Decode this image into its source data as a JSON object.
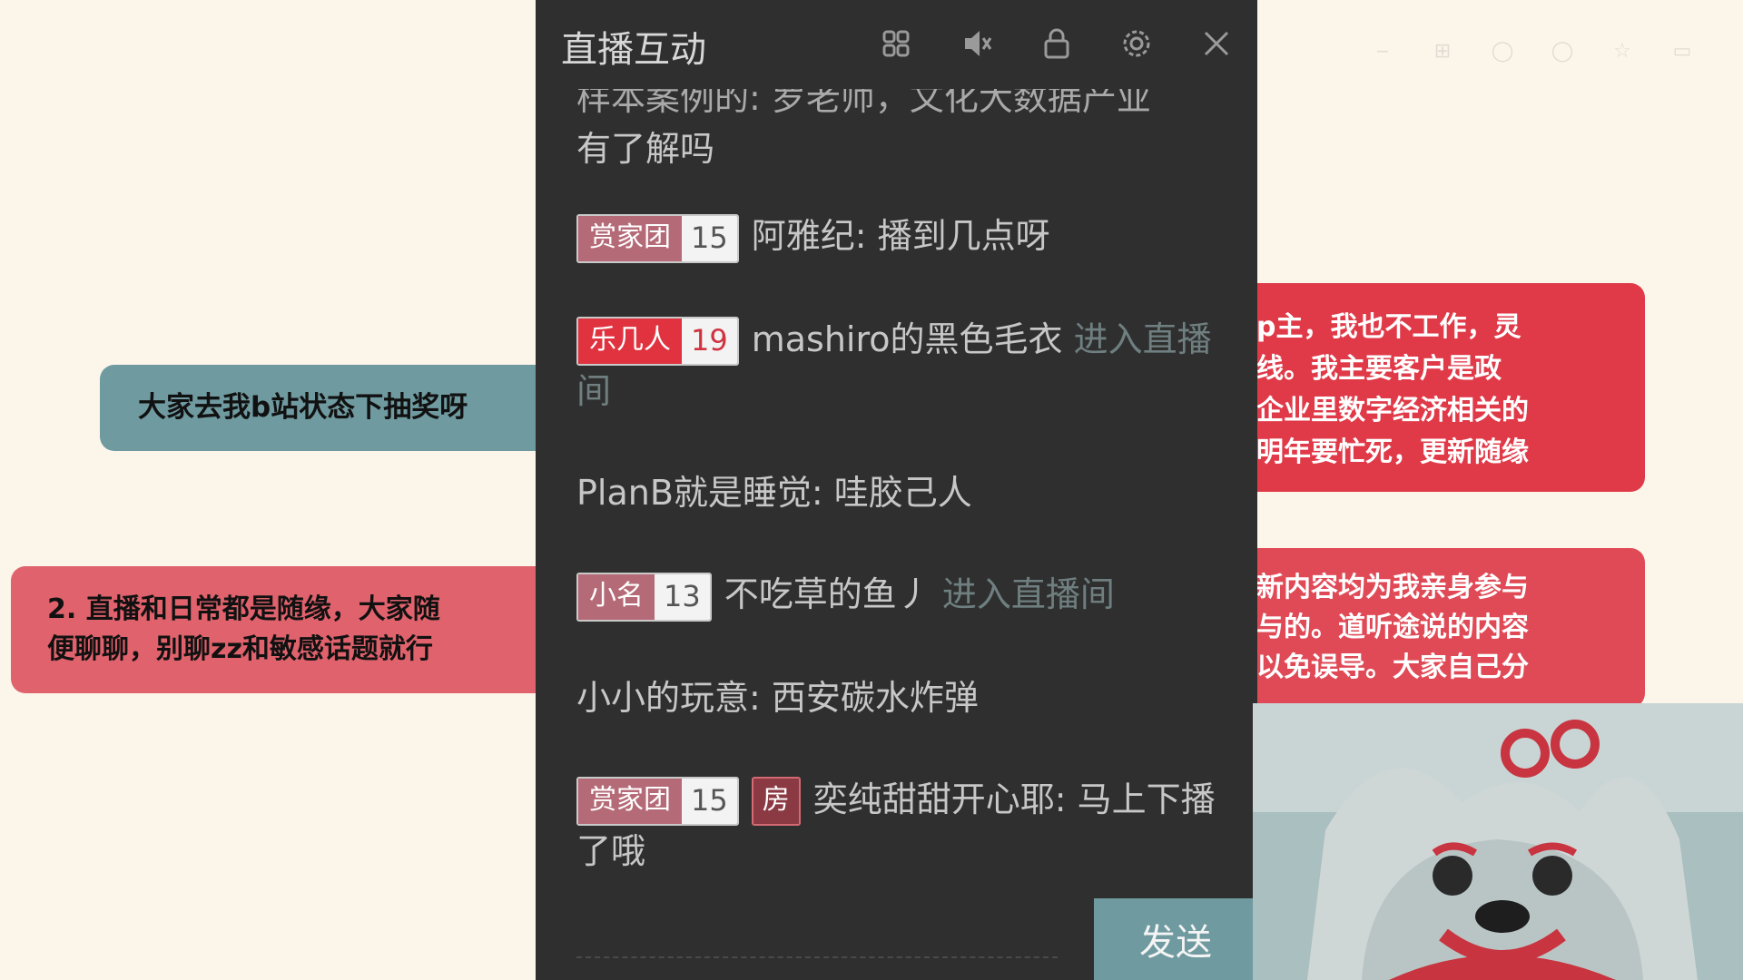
{
  "panel": {
    "title": "直播互动",
    "icons": [
      "expand-icon",
      "mute-icon",
      "lock-icon",
      "settings-icon",
      "close-icon"
    ],
    "send_label": "发送"
  },
  "messages": [
    {
      "type": "text",
      "lines": [
        "样本案例的: 罗老师，文化大数据产业",
        "有了解吗"
      ]
    },
    {
      "type": "badged",
      "badge_name": "赏家团",
      "badge_level": "15",
      "user": "阿雅纪",
      "text": ": 播到几点呀"
    },
    {
      "type": "enter",
      "badge_name": "乐几人",
      "badge_level": "19",
      "user": "mashiro的黑色毛衣",
      "text": "进入直播间"
    },
    {
      "type": "plain",
      "user": "PlanB就是睡觉",
      "text": ": 哇胶己人"
    },
    {
      "type": "enter",
      "badge_name": "小名",
      "badge_level": "13",
      "user": "不吃草的鱼丿",
      "text": "进入直播间"
    },
    {
      "type": "plain",
      "user": "小小的玩意",
      "text": ": 西安碳水炸弹"
    },
    {
      "type": "room",
      "badge_name": "赏家团",
      "badge_level": "15",
      "room": "房",
      "user": "奕纯甜甜开心耶",
      "text": ": 马上下播了哦"
    }
  ],
  "notes": {
    "teal": "大家去我b站状态下抽奖呀",
    "red_left": [
      "2. 直播和日常都是随缘，大家随",
      "便聊聊，别聊zz和敏感话题就行"
    ],
    "red_right_top": [
      "p主，我也不工作，灵",
      "线。我主要客户是政",
      "企业里数字经济相关的",
      "明年要忙死，更新随缘"
    ],
    "red_right_bottom": [
      "新内容均为我亲身参与",
      "与的。道听途说的内容",
      "以免误导。大家自己分"
    ]
  },
  "colors": {
    "background": "#fbf5ea",
    "panel": "#2f2f2f",
    "accent_teal": "#6f9aa0",
    "accent_red": "#e03a48"
  }
}
